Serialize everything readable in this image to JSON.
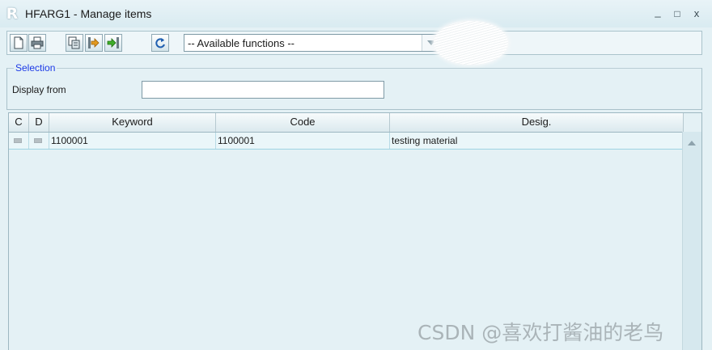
{
  "window": {
    "logo": "R",
    "title": "HFARG1 - Manage items",
    "controls": [
      {
        "name": "minimize",
        "glyph": "_"
      },
      {
        "name": "maximize",
        "glyph": "□"
      },
      {
        "name": "close",
        "glyph": "x"
      }
    ]
  },
  "toolbar": {
    "buttons": [
      {
        "name": "new-document-icon"
      },
      {
        "name": "print-icon"
      },
      {
        "name": "copy-icon"
      },
      {
        "name": "import-icon"
      },
      {
        "name": "export-icon"
      },
      {
        "name": "refresh-icon"
      }
    ],
    "functions_select": "-- Available functions --"
  },
  "selection": {
    "legend": "Selection",
    "display_from_label": "Display from",
    "display_from_value": ""
  },
  "grid": {
    "columns": [
      "C",
      "D",
      "Keyword",
      "Code",
      "Desig."
    ],
    "rows": [
      {
        "keyword": "1100001",
        "code": "1100001",
        "desig": "testing material"
      }
    ]
  },
  "watermark": "CSDN @喜欢打酱油的老鸟",
  "colors": {
    "legend": "#1b39e6",
    "background": "#e4f1f5",
    "row_border": "#9dd3e3"
  }
}
